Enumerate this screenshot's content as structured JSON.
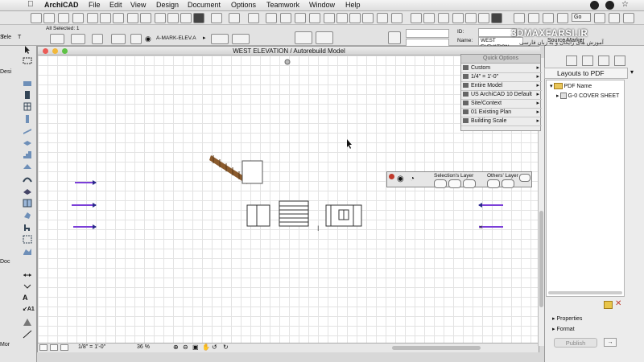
{
  "menu": {
    "apple_icon": "apple-icon",
    "app": "ArchiCAD",
    "items": [
      "File",
      "Edit",
      "View",
      "Design",
      "Document",
      "Options",
      "Teamwork",
      "Window",
      "Help"
    ]
  },
  "info_box": {
    "all_selected": "All Selected: 1",
    "mark_label": "A-MARK-ELEV.A",
    "id_label": "ID:",
    "name_label": "Name:",
    "name_value": "WEST ELEVATION",
    "source_marker": "Source Marker",
    "arrow_field": "▸"
  },
  "toolbox": {
    "labels": [
      "Sele",
      "Desi",
      "Doc",
      "Mor"
    ]
  },
  "window": {
    "title": "WEST ELEVATION / Autorebuild Model",
    "scale": "1/8\"  =  1'-0\"",
    "zoom": "36 %"
  },
  "quick_options": {
    "header": "Quick Options",
    "rows": [
      "Custom",
      "1/4\"   =    1'-0\"",
      "Entire Model",
      "US ArchiCAD 10 Default",
      "Site/Context",
      "01 Existing Plan",
      "Building Scale"
    ]
  },
  "layer_palette": {
    "selection_label": "Selection's Layer",
    "others_label": "Others' Layer"
  },
  "right_panel": {
    "brand_line1": "3DMAXFARSI.IR",
    "brand_line2": "آموزش های رایگان و به زبان فارسی",
    "layouts_label": "Layouts to PDF",
    "tree_root": "PDF Name",
    "tree_child": "G-0 COVER SHEET",
    "properties": "Properties",
    "format": "Format",
    "publish": "Publish"
  },
  "colors": {
    "close_dot": "#ec5b56",
    "min_dot": "#f2b83a",
    "max_dot": "#5ec245",
    "marker": "#7b3fd8",
    "stair": "#8a5a2c"
  }
}
